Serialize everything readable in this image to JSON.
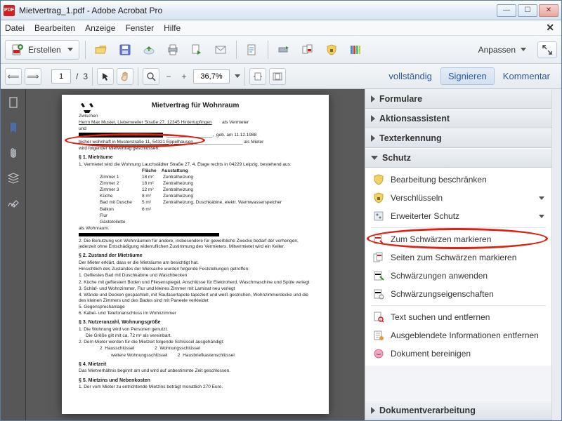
{
  "window": {
    "title": "Mietvertrag_1.pdf - Adobe Acrobat Pro"
  },
  "menu": {
    "file": "Datei",
    "edit": "Bearbeiten",
    "view": "Anzeige",
    "window": "Fenster",
    "help": "Hilfe"
  },
  "toolbar": {
    "create": "Erstellen",
    "customize": "Anpassen"
  },
  "nav": {
    "page_current": "1",
    "page_sep": "/",
    "page_total": "3",
    "zoom": "36,7%"
  },
  "viewbar": {
    "full": "vollständig",
    "sign": "Signieren",
    "comment": "Kommentar"
  },
  "doc": {
    "title": "Mietvertrag für Wohnraum",
    "between": "Zwischen",
    "landlord_line": "Herrn Max Muster, Liebenweiler Straße 27, 12345 Hintertupfingen",
    "landlord_role": "als Vermieter",
    "and": "und",
    "born": "geb. am 11.12.1988",
    "tenant_addr": "bisher wohnhaft in Musterstraße 11, 54321 Eppelhausen",
    "tenant_role": "als Mieter",
    "closed": "wird folgender Mietvertrag geschlossen:",
    "s1": "§ 1.  Mieträume",
    "s1_1": "1.  Vermietet wird die Wohnung Lauchstädter Straße 27, 4. Etage rechts in 04229 Leipzig, bestehend aus:",
    "col_area": "Fläche",
    "col_equip": "Ausstattung",
    "rooms": [
      {
        "n": "Zimmer 1",
        "a": "18 m²",
        "e": "Zentralheizung"
      },
      {
        "n": "Zimmer 2",
        "a": "18 m²",
        "e": "Zentralheizung"
      },
      {
        "n": "Zimmer 3",
        "a": "12 m²",
        "e": "Zentralheizung"
      },
      {
        "n": "Küche",
        "a": "8 m²",
        "e": "Zentralheizung"
      },
      {
        "n": "Bad mit Dusche",
        "a": "5 m²",
        "e": "Zentralheizung, Duschkabine, elektr. Warmwasserspeicher"
      },
      {
        "n": "Balkon",
        "a": "6 m²",
        "e": ""
      },
      {
        "n": "Flur",
        "a": "",
        "e": ""
      },
      {
        "n": "Gästetoilette",
        "a": "",
        "e": ""
      }
    ],
    "rooms_footer": "als Wohnraum.",
    "s1_2": "2.  Die Benutzung von Wohnräumen für andere, insbesondere für gewerbliche Zwecke bedarf der vorherigen, jederzeit ohne Entschädigung widerruflichen Zustimmung des Vermieters. Mitvermietet wird ein Keller.",
    "s2": "§ 2.  Zustand der Mieträume",
    "s2_l1": "Der Mieter erklärt, dass er die Mieträume am                       besichtigt hat.",
    "s2_l2": "Hinsichtlich des Zustandes der Mietsache wurden folgende Feststellungen getroffen:",
    "s2_items": [
      "1.  Gefliestes Bad mit Duschkabine und Waschbecken",
      "2.  Küche mit gefliestem Boden und Fliesenspiegel, Anschlüsse für Elektroherd, Waschmaschine und Spüle verlegt",
      "3.  Schlaf- und Wohnzimmer, Flur und kleines Zimmer mit Laminat neu verlegt",
      "4.  Wände und Decken gespachtelt, mit Raufasertapete tapeziert und weiß gestrichen, Wohnzimmerdecke und die des kleinen Zimmers und des Bades sind mit Paneele verkleidet",
      "5.  Gegensprechanlage",
      "6.  Kabel- und Telefonanschluss im Wohnzimmer"
    ],
    "s3": "§ 3.  Nutzeranzahl, Wohnungsgröße",
    "s3_1": "1.  Die Wohnung wird von        Personen genutzt.",
    "s3_2": "Die Größe gilt mit ca. 72 m² als vereinbart.",
    "s3_3": "2.  Dem Mieter werden für die Mietzeit folgende Schlüssel ausgehändigt:",
    "key1n": "2",
    "key1": "Hausschlüssel",
    "key2n": "2",
    "key2": "Wohnungsschlüssel",
    "key3": "weitere Wohnungsschlüssel",
    "key4n": "2",
    "key4": "Hausbriefkastenschlüssel",
    "s4": "§ 4.  Mietzeit",
    "s4_1": "Das Mietverhältnis beginnt am                       und wird auf unbestimmte Zeit geschlossen.",
    "s5": "§ 5.  Mietzins und Nebenkosten",
    "s5_1": "1.  Der vom Mieter zu entrichtende Mietzins beträgt monatlich 270 Euro."
  },
  "panels": {
    "formulare": "Formulare",
    "aktion": "Aktionsassistent",
    "ocr": "Texterkennung",
    "schutz": "Schutz",
    "docproc": "Dokumentverarbeitung"
  },
  "schutz_tools": {
    "restrict": "Bearbeitung beschränken",
    "encrypt": "Verschlüsseln",
    "advanced": "Erweiterter Schutz",
    "mark_redact": "Zum Schwärzen markieren",
    "mark_pages": "Seiten zum Schwärzen markieren",
    "apply_redact": "Schwärzungen anwenden",
    "redact_props": "Schwärzungseigenschaften",
    "search_remove": "Text suchen und entfernen",
    "hidden_info": "Ausgeblendete Informationen entfernen",
    "sanitize": "Dokument bereinigen"
  }
}
